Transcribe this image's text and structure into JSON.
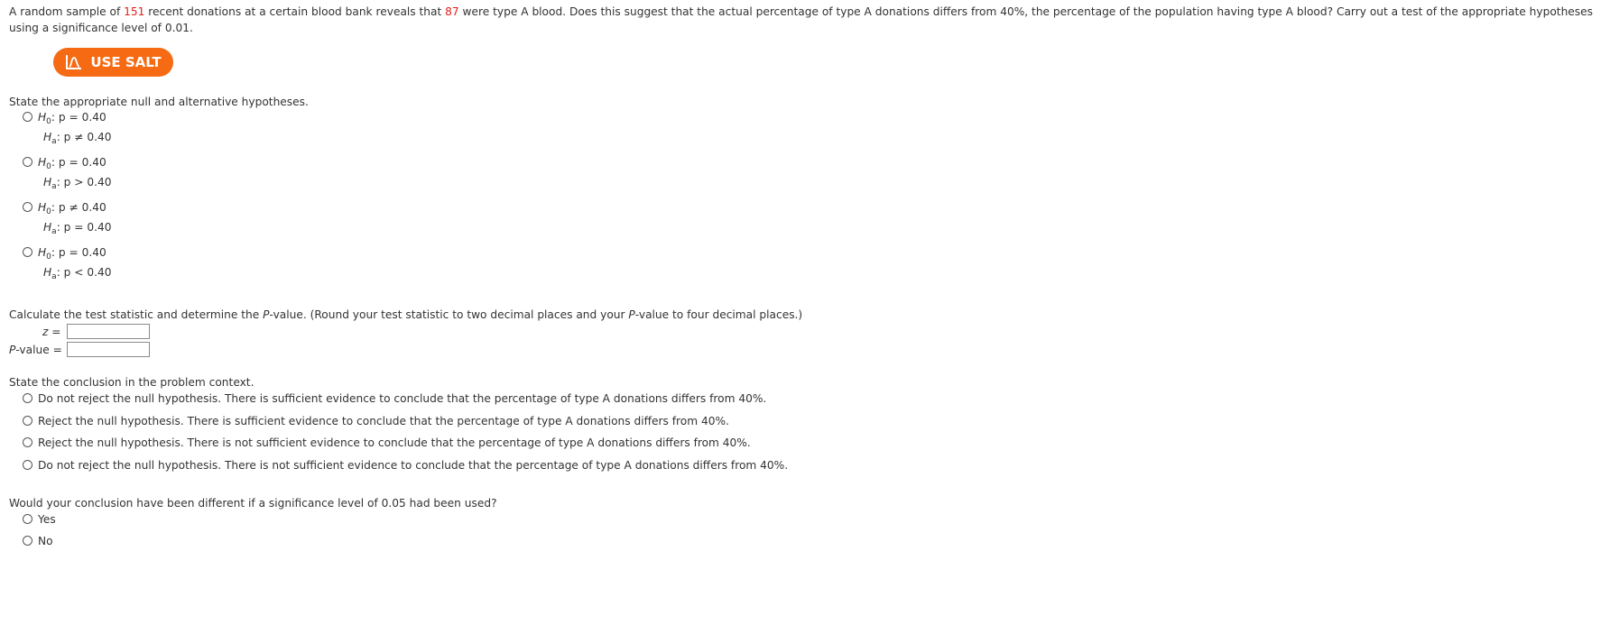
{
  "intro": {
    "part1": "A random sample of ",
    "sample_size": "151",
    "part2": " recent donations at a certain blood bank reveals that ",
    "count_a": "87",
    "part3": " were type A blood. Does this suggest that the actual percentage of type A donations differs from 40%, the percentage of the population having type A blood? Carry out a test of the appropriate hypotheses using a significance level of 0.01."
  },
  "salt_button": {
    "label": "USE SALT",
    "icon": "salt-chart-icon",
    "color": "#f56a12"
  },
  "hypotheses": {
    "prompt": "State the appropriate null and alternative hypotheses.",
    "h0_letter": "H",
    "h0_sub": "0",
    "ha_letter": "H",
    "ha_sub": "a",
    "options": [
      {
        "h0": ": p = 0.40",
        "ha": ": p ≠ 0.40"
      },
      {
        "h0": ": p = 0.40",
        "ha": ": p > 0.40"
      },
      {
        "h0": ": p ≠ 0.40",
        "ha": ": p = 0.40"
      },
      {
        "h0": ": p = 0.40",
        "ha": ": p < 0.40"
      }
    ]
  },
  "calculation": {
    "prompt_part1": "Calculate the test statistic and determine the ",
    "prompt_p": "P",
    "prompt_part2": "-value. (Round your test statistic to two decimal places and your ",
    "prompt_p2": "P",
    "prompt_part3": "-value to four decimal places.)",
    "z_label": "z =",
    "z_value": "",
    "p_label_p": "P",
    "p_label_rest": "-value =",
    "p_value": ""
  },
  "conclusion": {
    "prompt": "State the conclusion in the problem context.",
    "options": [
      "Do not reject the null hypothesis. There is sufficient evidence to conclude that the percentage of type A donations differs from 40%.",
      "Reject the null hypothesis. There is sufficient evidence to conclude that the percentage of type A donations differs from 40%.",
      "Reject the null hypothesis. There is not sufficient evidence to conclude that the percentage of type A donations differs from 40%.",
      "Do not reject the null hypothesis. There is not sufficient evidence to conclude that the percentage of type A donations differs from 40%."
    ]
  },
  "followup": {
    "prompt": "Would your conclusion have been different if a significance level of 0.05 had been used?",
    "options": [
      "Yes",
      "No"
    ]
  }
}
